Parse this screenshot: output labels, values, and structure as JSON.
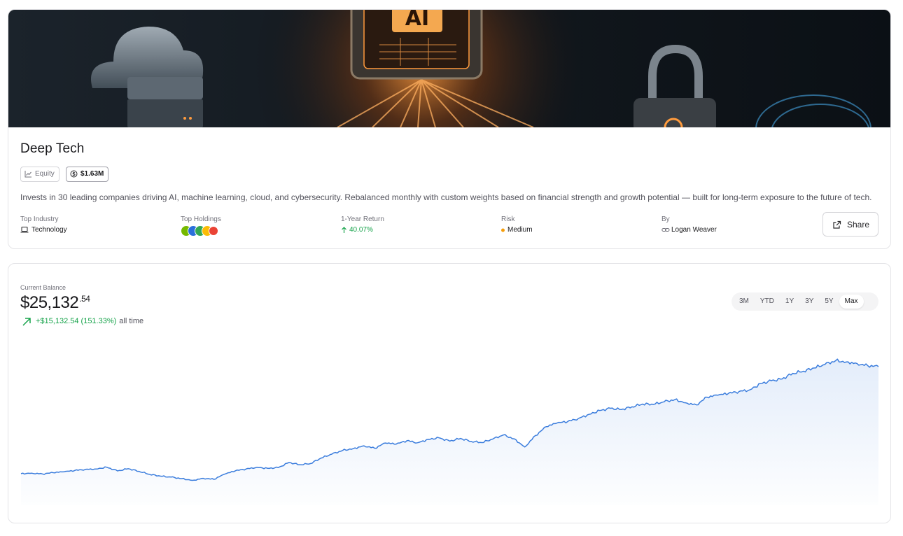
{
  "portfolio": {
    "name": "Deep Tech",
    "type_badge": "Equity",
    "aum_badge": "$1.63M",
    "description": "Invests in 30 leading companies driving AI, machine learning, cloud, and cybersecurity. Rebalanced monthly with custom weights based on financial strength and growth potential — built for long-term exposure to the future of tech.",
    "banner_text": "AI"
  },
  "stats": {
    "top_industry_label": "Top Industry",
    "top_industry_value": "Technology",
    "top_holdings_label": "Top Holdings",
    "one_year_return_label": "1-Year Return",
    "one_year_return_value": "40.07%",
    "risk_label": "Risk",
    "risk_value": "Medium",
    "by_label": "By",
    "by_value": "Logan Weaver"
  },
  "share_label": "Share",
  "balance": {
    "label": "Current Balance",
    "value_main": "$25,132",
    "value_cents": ".54",
    "gain": "+$15,132.54 (151.33%)",
    "gain_suffix": "all time"
  },
  "range_tabs": [
    "3M",
    "YTD",
    "1Y",
    "3Y",
    "5Y",
    "Max"
  ],
  "active_range": "Max",
  "colors": {
    "accent_line": "#3b7ddd",
    "positive": "#16a34a",
    "risk_medium": "#f59e0b",
    "holdings_logo_colors": [
      "#76b900",
      "#2a6fdb",
      "#34a853",
      "#fbbc05",
      "#ea4335"
    ]
  },
  "chart_data": {
    "type": "area",
    "title": "",
    "xlabel": "",
    "ylabel": "",
    "y_unit": "USD",
    "grid": false,
    "legend": "none",
    "x": [
      0,
      1,
      2,
      3,
      4,
      5,
      6,
      7,
      8,
      9,
      10,
      11,
      12,
      13,
      14,
      15,
      16,
      17,
      18,
      19,
      20,
      21,
      22,
      23,
      24,
      25,
      26,
      27,
      28,
      29,
      30,
      31,
      32,
      33,
      34,
      35,
      36,
      37,
      38,
      39,
      40,
      41,
      42,
      43,
      44,
      45,
      46,
      47,
      48,
      49,
      50,
      51,
      52,
      53,
      54,
      55,
      56,
      57,
      58,
      59,
      60,
      61,
      62,
      63,
      64,
      65,
      66,
      67,
      68,
      69,
      70,
      71,
      72,
      73,
      74,
      75,
      76,
      77,
      78,
      79,
      80
    ],
    "values": [
      10000,
      10070,
      9960,
      10140,
      10260,
      10440,
      10600,
      10660,
      10910,
      10380,
      10700,
      10330,
      9900,
      9650,
      9510,
      9300,
      9050,
      9340,
      9200,
      9930,
      10400,
      10660,
      10900,
      10750,
      10850,
      11570,
      11260,
      11420,
      12200,
      12760,
      13280,
      13540,
      13940,
      13590,
      14330,
      14170,
      14660,
      14370,
      14850,
      15060,
      14600,
      14970,
      14560,
      14390,
      14880,
      15470,
      14920,
      13770,
      15390,
      16640,
      17150,
      17360,
      17800,
      18390,
      18920,
      19240,
      19060,
      19440,
      19840,
      19780,
      20160,
      20470,
      20020,
      19720,
      20810,
      21090,
      21330,
      21620,
      21850,
      22720,
      23130,
      23380,
      24170,
      24480,
      24930,
      25430,
      25970,
      25790,
      25560,
      25260,
      25132.54
    ]
  }
}
